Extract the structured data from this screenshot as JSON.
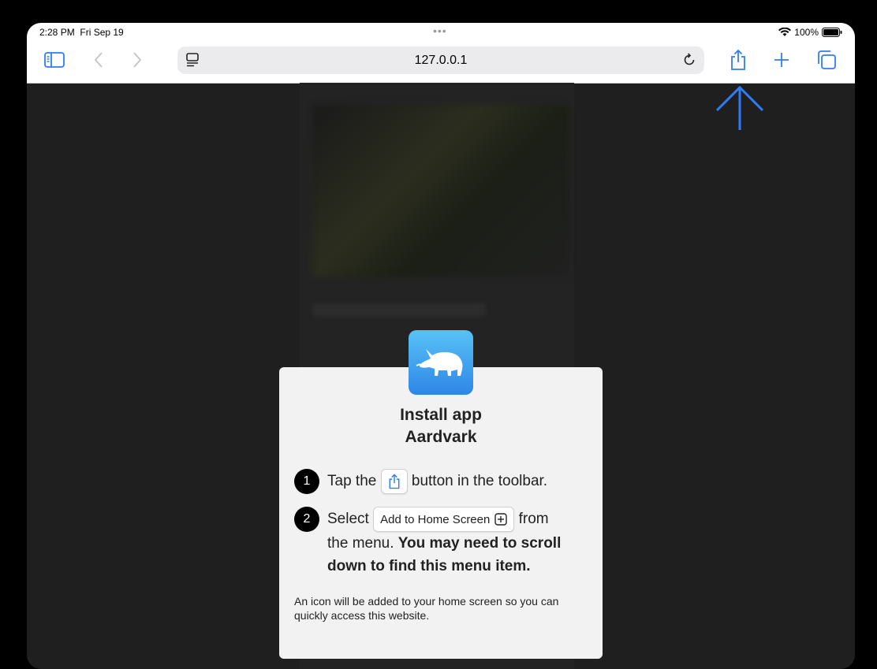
{
  "status_bar": {
    "time": "2:28 PM",
    "date": "Fri Sep 19",
    "dots": "•••",
    "battery": "100%"
  },
  "toolbar": {
    "address": "127.0.0.1",
    "icons": [
      "sidebar-icon",
      "back-icon",
      "forward-icon",
      "reader-icon",
      "reload-icon",
      "share-icon",
      "new-tab-icon",
      "tabs-icon"
    ],
    "accent": "#2f7cf6"
  },
  "modal": {
    "title_line1": "Install app",
    "title_line2": "Aardvark",
    "step1": {
      "num": "1",
      "prefix": "Tap the",
      "suffix": "button in the toolbar."
    },
    "step2": {
      "num": "2",
      "prefix": "Select",
      "chip_label": "Add to Home Screen",
      "suffix": "from",
      "line2": "the menu.",
      "bold": "You may need to scroll down to find this menu item."
    },
    "footnote": "An icon will be added to your home screen so you can quickly access this website."
  }
}
